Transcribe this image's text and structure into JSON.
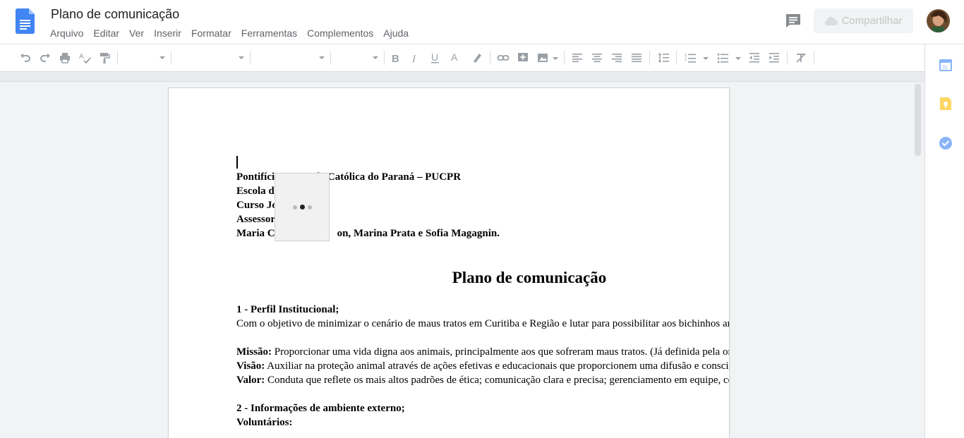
{
  "app": {
    "title": "Plano de comunicação"
  },
  "menu": [
    "Arquivo",
    "Editar",
    "Ver",
    "Inserir",
    "Formatar",
    "Ferramentas",
    "Complementos",
    "Ajuda"
  ],
  "share": {
    "label": "Compartilhar"
  },
  "colors": {
    "docs_blue": "#4285f4",
    "canvas_bg": "#f1f3f4",
    "menu_text": "#5f6368"
  },
  "toolbar": {
    "icons": [
      "undo-icon",
      "redo-icon",
      "print-icon",
      "spellcheck-icon",
      "paint-format-icon",
      "bold-icon",
      "italic-icon",
      "underline-icon",
      "text-color-icon",
      "highlight-icon",
      "link-icon",
      "insert-comment-icon",
      "insert-image-icon",
      "align-left-icon",
      "align-center-icon",
      "align-right-icon",
      "align-justify-icon",
      "line-spacing-icon",
      "numbered-list-icon",
      "bulleted-list-icon",
      "decrease-indent-icon",
      "increase-indent-icon",
      "clear-formatting-icon"
    ]
  },
  "document": {
    "header_lines": [
      {
        "a": "Pontifíci",
        "b": "de Católica do Paraná – PUCPR"
      },
      {
        "a": "Escola d",
        "b": ""
      },
      {
        "a": "Curso Jo",
        "b": ""
      },
      {
        "a": "Assessor",
        "b": "sa"
      },
      {
        "a": "Maria C",
        "b": "on, Marina Prata e Sofia Magagnin."
      }
    ],
    "heading": "Plano de comunicação",
    "section1_title": "1 - Perfil Institucional;",
    "section1_text": "Com o objetivo de minimizar o cenário de maus tratos em Curitiba e Região e lutar para possibilitar aos bichinhos amo",
    "missao_label": "Missão:",
    "missao_text": " Proporcionar uma vida digna aos animais, principalmente aos que sofreram maus tratos. (Já definida pela orga",
    "visao_label": "Visão:",
    "visao_text": " Auxiliar na proteção animal através de ações efetivas e educacionais que proporcionem uma difusão e conscient",
    "valor_label": "Valor:",
    "valor_text": " Conduta que reflete os mais altos padrões de ética; comunicação clara e precisa; gerenciamento em equipe, cons",
    "section2_title": "2 - Informações de ambiente externo;",
    "voluntarios_label": "Voluntários:"
  }
}
